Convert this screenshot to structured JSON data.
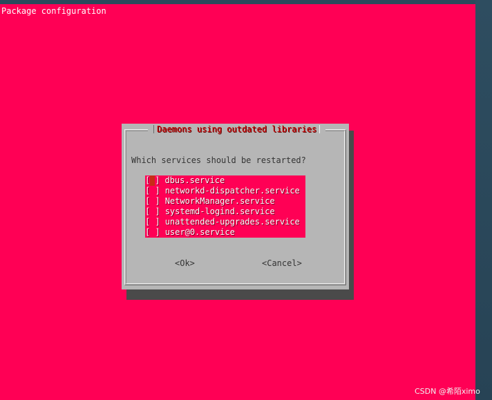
{
  "terminal": {
    "title": "Package configuration",
    "background": "#ff0055"
  },
  "dialog": {
    "title": "Daemons using outdated libraries",
    "question": "Which services should be restarted?",
    "services": [
      {
        "label": "dbus.service",
        "checked": false,
        "focused": true
      },
      {
        "label": "networkd-dispatcher.service",
        "checked": false,
        "focused": false
      },
      {
        "label": "NetworkManager.service",
        "checked": false,
        "focused": false
      },
      {
        "label": "systemd-logind.service",
        "checked": false,
        "focused": false
      },
      {
        "label": "unattended-upgrades.service",
        "checked": false,
        "focused": false
      },
      {
        "label": "user@0.service",
        "checked": false,
        "focused": false
      }
    ],
    "ok_label": "<Ok>",
    "cancel_label": "<Cancel>"
  },
  "watermark": "CSDN @希陌ximo"
}
